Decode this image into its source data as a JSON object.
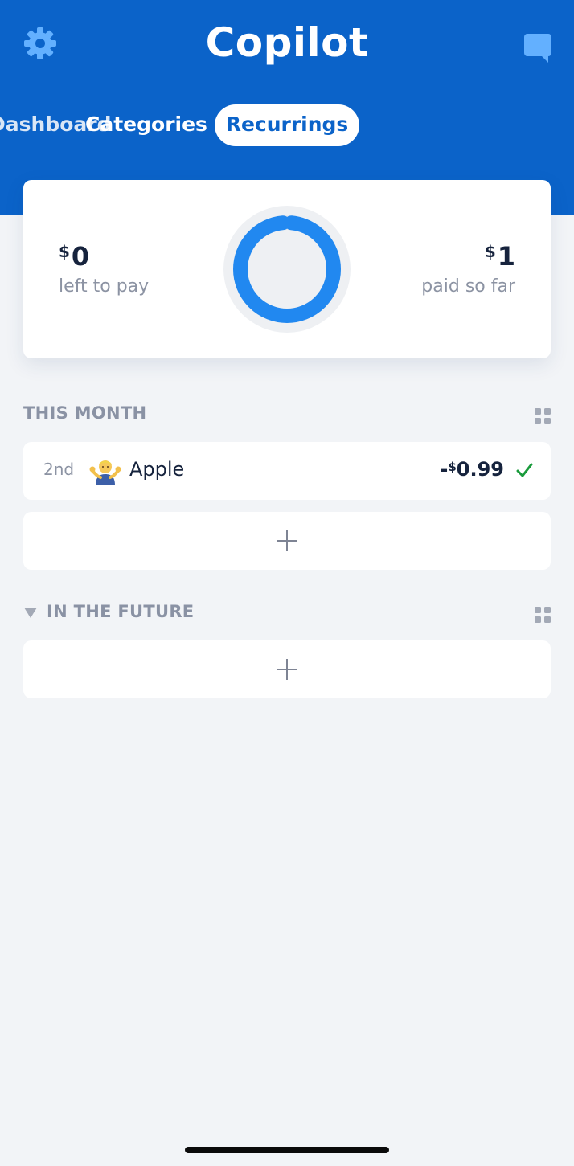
{
  "header": {
    "title": "Copilot",
    "settings_icon": "gear-icon",
    "chat_icon": "chat-bubble-icon"
  },
  "tabs": [
    {
      "label": "Dashboard",
      "active": false
    },
    {
      "label": "Categories",
      "active": false
    },
    {
      "label": "Recurrings",
      "active": true
    }
  ],
  "summary": {
    "currency": "$",
    "left_to_pay_amount": "0",
    "left_to_pay_label": "left to pay",
    "paid_so_far_amount": "1",
    "paid_so_far_label": "paid so far",
    "progress_fraction": 0.97
  },
  "sections": {
    "this_month": {
      "title": "THIS MONTH",
      "items": [
        {
          "day": "2nd",
          "emoji": "person-shrugging-icon",
          "name": "Apple",
          "sign": "-",
          "currency": "$",
          "amount": "0.99",
          "status": "paid-check-icon"
        }
      ]
    },
    "in_the_future": {
      "title": "IN THE FUTURE"
    }
  },
  "colors": {
    "brand_blue": "#0b63c9",
    "ring_blue": "#2188f0",
    "background": "#f2f4f7",
    "check_green": "#1a9b3c"
  }
}
